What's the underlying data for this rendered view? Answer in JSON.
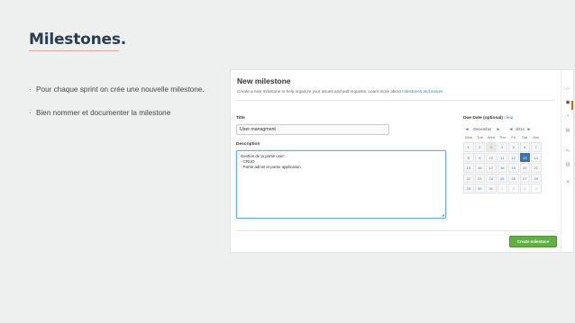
{
  "slide": {
    "title": "Milestones.",
    "bullets": [
      {
        "marker": "·",
        "text": "Pour chaque sprint on crée une nouvelle milestone."
      },
      {
        "marker": "·",
        "text": "Bien nommer et documenter la milestone"
      }
    ]
  },
  "screenshot": {
    "heading": "New milestone",
    "subtitle": "Create a new milestone to help organize your issues and pull requests. Learn more about",
    "subtitle_link": "milestones and issues.",
    "title_label": "Title",
    "title_value": "User managment",
    "description_label": "Description",
    "description_lines": [
      "Gestion de la partie user:",
      "- CRUD",
      "- Partie admin et partie application"
    ],
    "due_label": "Due Date (optional)",
    "due_clear": "clear",
    "calendar": {
      "prev": "◄",
      "month": "December",
      "next": "►",
      "year_prev": "◄",
      "year": "2014",
      "year_next": "►",
      "weekdays": [
        "Mon",
        "Tue",
        "Wed",
        "Thu",
        "Fri",
        "Sat",
        "Sun"
      ],
      "rows": [
        [
          "1",
          "2",
          "3",
          "4",
          "5",
          "6",
          "7"
        ],
        [
          "8",
          "9",
          "10",
          "11",
          "12",
          "13",
          "14"
        ],
        [
          "15",
          "16",
          "17",
          "18",
          "19",
          "20",
          "21"
        ],
        [
          "22",
          "23",
          "24",
          "25",
          "26",
          "27",
          "28"
        ],
        [
          "29",
          "30",
          "31",
          "1",
          "2",
          "3",
          "4"
        ]
      ],
      "selected": "13",
      "today": "3"
    },
    "create_button": "Create milestone",
    "rail_icons": [
      "code-icon",
      "issues-icon",
      "pull-request-icon",
      "wiki-icon",
      "pulse-icon",
      "graphs-icon",
      "settings-icon"
    ],
    "colors": {
      "accent": "#4183c4",
      "button": "#60b044",
      "selected_day": "#3b73af",
      "active_tab": "#d26911"
    }
  }
}
